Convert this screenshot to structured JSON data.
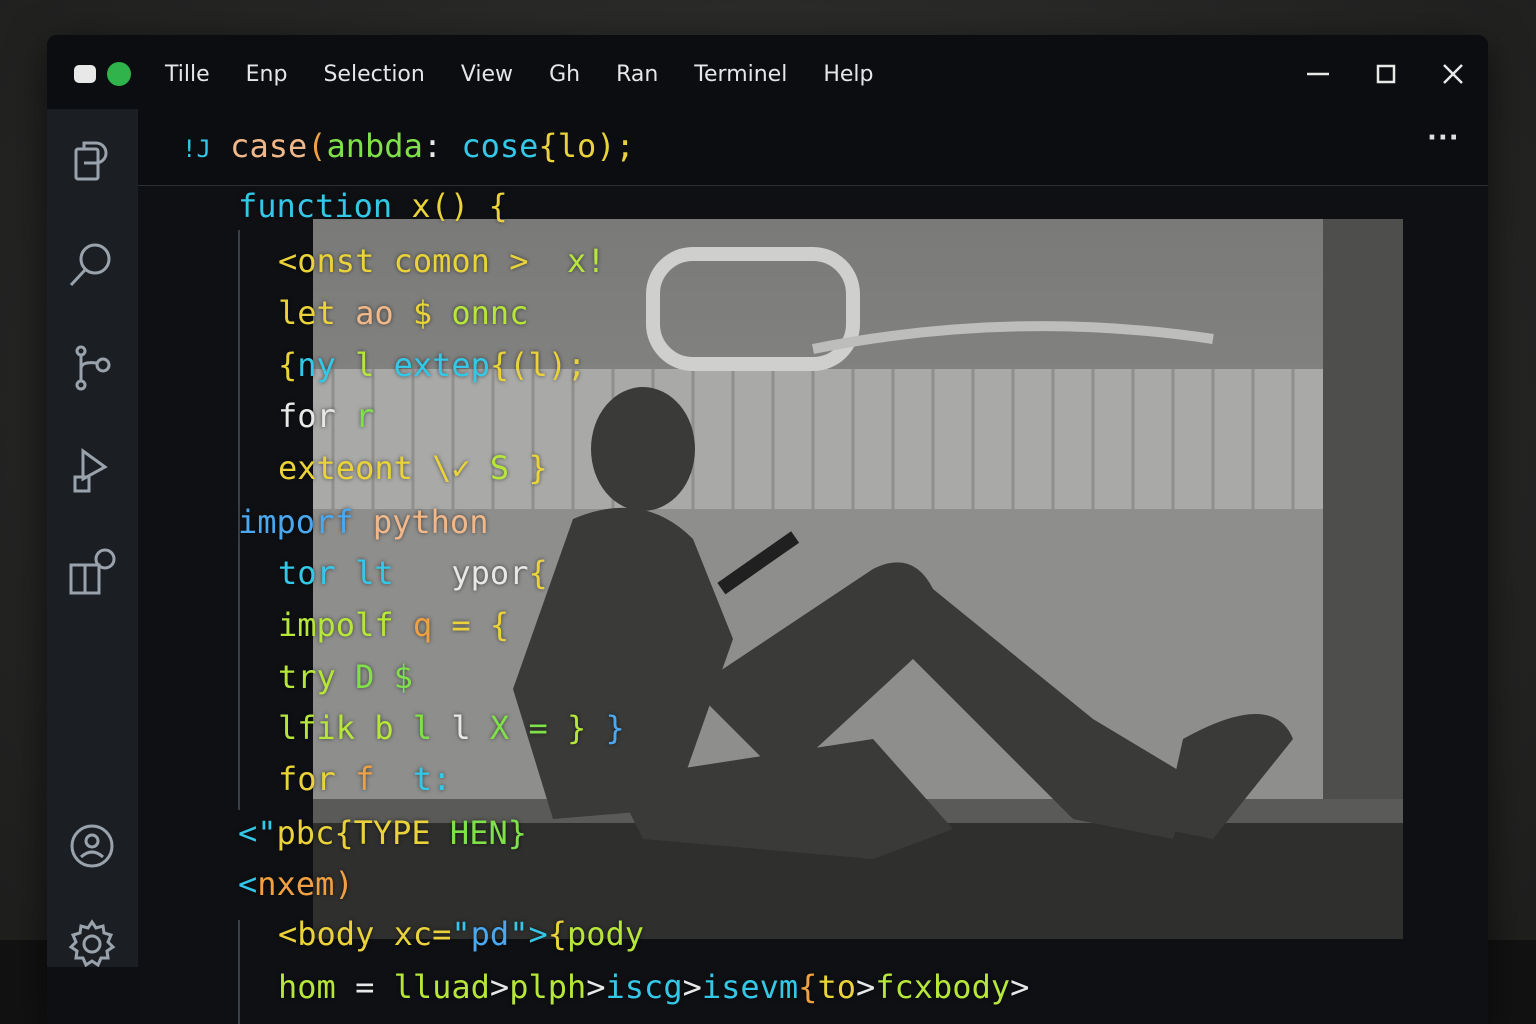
{
  "window": {
    "menu": [
      "Tille",
      "Enp",
      "Selection",
      "View",
      "Gh",
      "Ran",
      "Terminel",
      "Help"
    ],
    "controls": {
      "minimize": "minimize-icon",
      "maximize": "maximize-icon",
      "close": "close-icon"
    }
  },
  "activity_bar": {
    "top_icons": [
      "files-icon",
      "search-icon",
      "source-control-icon",
      "run-debug-icon",
      "extensions-icon"
    ],
    "bottom_icons": [
      "account-icon",
      "settings-gear-icon"
    ]
  },
  "tab": {
    "prefix": "!J",
    "title_parts": [
      {
        "text": "case",
        "color": "#f0b88a"
      },
      {
        "text": "(",
        "color": "#f0a040"
      },
      {
        "text": "anbda",
        "color": "#7fe04a"
      },
      {
        "text": ": ",
        "color": "#e8e8e8"
      },
      {
        "text": "cose",
        "color": "#34c8e8"
      },
      {
        "text": "{",
        "color": "#e9d23a"
      },
      {
        "text": "lo",
        "color": "#e9d23a"
      },
      {
        "text": ");",
        "color": "#e9d23a"
      }
    ],
    "more": "···"
  },
  "code_lines": [
    {
      "indent": 0,
      "parts": [
        {
          "t": "function ",
          "c": "c-cyan"
        },
        {
          "t": "x() {",
          "c": "c-yellow"
        }
      ]
    },
    {
      "indent": 1,
      "parts": [
        {
          "t": "<onst ",
          "c": "c-yellow"
        },
        {
          "t": "comon ",
          "c": "c-yellow"
        },
        {
          "t": ">  ",
          "c": "c-yellow"
        },
        {
          "t": "x!",
          "c": "c-lime"
        }
      ]
    },
    {
      "indent": 1,
      "parts": [
        {
          "t": "let ",
          "c": "c-yellow"
        },
        {
          "t": "ao ",
          "c": "c-peach"
        },
        {
          "t": "$ ",
          "c": "c-yellow"
        },
        {
          "t": "onnc",
          "c": "c-lime"
        }
      ]
    },
    {
      "indent": 1,
      "parts": [
        {
          "t": "{",
          "c": "c-yellow"
        },
        {
          "t": "ny ",
          "c": "c-cyan"
        },
        {
          "t": "l ",
          "c": "c-lime"
        },
        {
          "t": "extep",
          "c": "c-cyan"
        },
        {
          "t": "{(l);",
          "c": "c-yellow"
        }
      ]
    },
    {
      "indent": 1,
      "parts": [
        {
          "t": "for ",
          "c": "c-white"
        },
        {
          "t": "r",
          "c": "c-green"
        }
      ]
    },
    {
      "indent": 1,
      "parts": [
        {
          "t": "exteont ",
          "c": "c-yellow"
        },
        {
          "t": "\\✓ ",
          "c": "c-yellow"
        },
        {
          "t": "S ",
          "c": "c-lime"
        },
        {
          "t": "}",
          "c": "c-yellow"
        }
      ]
    },
    {
      "indent": 0,
      "parts": [
        {
          "t": "imporf ",
          "c": "c-blue"
        },
        {
          "t": "python",
          "c": "c-peach"
        }
      ]
    },
    {
      "indent": 1,
      "parts": [
        {
          "t": "tor ",
          "c": "c-cyan"
        },
        {
          "t": "lt ",
          "c": "c-cyan"
        },
        {
          "t": "  ",
          "c": "c-white"
        },
        {
          "t": "ypor",
          "c": "c-white"
        },
        {
          "t": "{",
          "c": "c-yellow"
        }
      ]
    },
    {
      "indent": 1,
      "parts": [
        {
          "t": "impolf ",
          "c": "c-lime"
        },
        {
          "t": "q ",
          "c": "c-orange"
        },
        {
          "t": "= {",
          "c": "c-yellow"
        }
      ]
    },
    {
      "indent": 1,
      "parts": [
        {
          "t": "try ",
          "c": "c-lime"
        },
        {
          "t": "D ",
          "c": "c-green"
        },
        {
          "t": "$",
          "c": "c-green"
        }
      ]
    },
    {
      "indent": 1,
      "parts": [
        {
          "t": "lfik ",
          "c": "c-lime"
        },
        {
          "t": "b ",
          "c": "c-lime"
        },
        {
          "t": "l ",
          "c": "c-green"
        },
        {
          "t": "l ",
          "c": "c-white"
        },
        {
          "t": "X ",
          "c": "c-green"
        },
        {
          "t": "= ",
          "c": "c-green"
        },
        {
          "t": "} ",
          "c": "c-lime"
        },
        {
          "t": "}",
          "c": "c-blue"
        }
      ]
    },
    {
      "indent": 1,
      "parts": [
        {
          "t": "for ",
          "c": "c-yellow"
        },
        {
          "t": "f  ",
          "c": "c-orange"
        },
        {
          "t": "t:",
          "c": "c-cyan"
        }
      ]
    },
    {
      "indent": 0,
      "parts": [
        {
          "t": "<\"",
          "c": "c-cyan"
        },
        {
          "t": "pbc",
          "c": "c-yellow"
        },
        {
          "t": "{TYPE ",
          "c": "c-yellow"
        },
        {
          "t": "HEN}",
          "c": "c-green"
        }
      ]
    },
    {
      "indent": 0,
      "parts": [
        {
          "t": "<",
          "c": "c-cyan"
        },
        {
          "t": "nxem",
          "c": "c-orange"
        },
        {
          "t": ")",
          "c": "c-orange"
        }
      ]
    },
    {
      "indent": 1,
      "parts": [
        {
          "t": "<body ",
          "c": "c-yellow"
        },
        {
          "t": "xc=",
          "c": "c-yellow"
        },
        {
          "t": "\"",
          "c": "c-cyan"
        },
        {
          "t": "pd",
          "c": "c-blue"
        },
        {
          "t": "\">",
          "c": "c-cyan"
        },
        {
          "t": "{",
          "c": "c-yellow"
        },
        {
          "t": "pody",
          "c": "c-lime"
        }
      ]
    },
    {
      "indent": 1,
      "parts": [
        {
          "t": "hom ",
          "c": "c-lime"
        },
        {
          "t": "= ",
          "c": "c-white"
        },
        {
          "t": "lluad",
          "c": "c-lime"
        },
        {
          "t": ">",
          "c": "c-white"
        },
        {
          "t": "plph",
          "c": "c-lime"
        },
        {
          "t": ">",
          "c": "c-white"
        },
        {
          "t": "iscg",
          "c": "c-cyan"
        },
        {
          "t": ">",
          "c": "c-white"
        },
        {
          "t": "isevm",
          "c": "c-cyan"
        },
        {
          "t": "{",
          "c": "c-orange"
        },
        {
          "t": "to",
          "c": "c-yellow"
        },
        {
          "t": ">",
          "c": "c-white"
        },
        {
          "t": "fcxbody",
          "c": "c-lime"
        },
        {
          "t": ">",
          "c": "c-white"
        }
      ]
    }
  ],
  "colors": {
    "titlebar": "#0b0d10",
    "activity_bar": "#1b1f24",
    "editor_bg": "#0e1013",
    "window_green_dot": "#2fb34a"
  }
}
